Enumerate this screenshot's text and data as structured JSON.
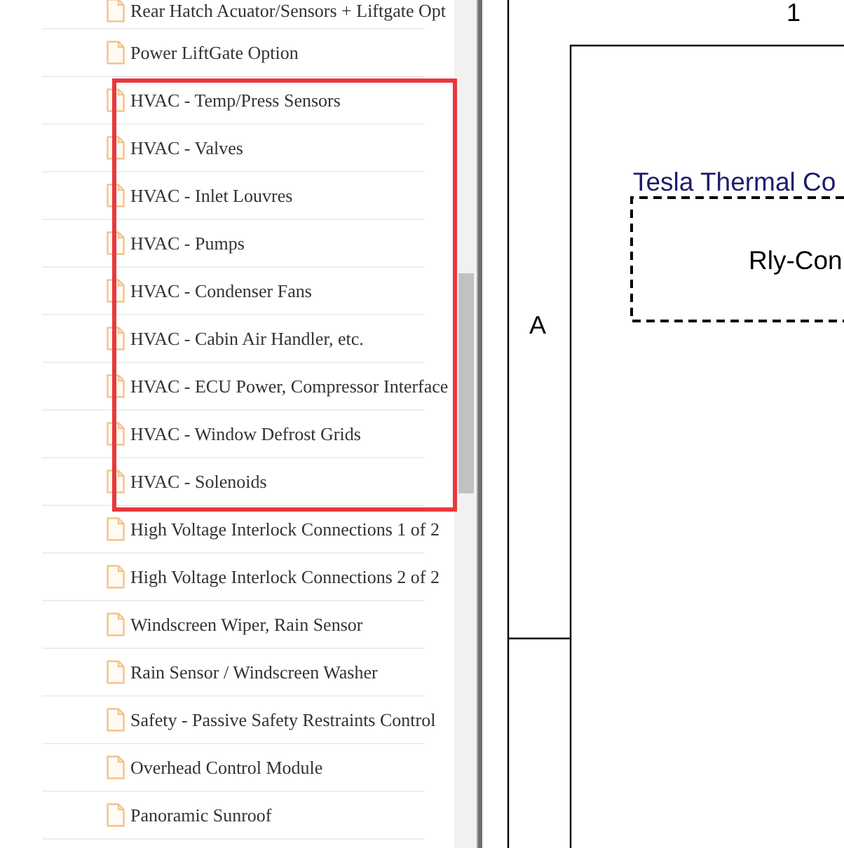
{
  "file_list": {
    "sections": [
      {
        "highlighted": false,
        "items": [
          {
            "label": "Rear Hatch Acuator/Sensors + Liftgate Opt"
          },
          {
            "label": "Power LiftGate Option"
          }
        ]
      },
      {
        "highlighted": true,
        "items": [
          {
            "label": "HVAC - Temp/Press Sensors"
          },
          {
            "label": "HVAC - Valves"
          },
          {
            "label": "HVAC - Inlet Louvres"
          },
          {
            "label": "HVAC - Pumps"
          },
          {
            "label": "HVAC - Condenser Fans"
          },
          {
            "label": "HVAC - Cabin Air Handler, etc."
          },
          {
            "label": "HVAC - ECU Power, Compressor Interface"
          },
          {
            "label": "HVAC - Window Defrost Grids"
          },
          {
            "label": "HVAC - Solenoids"
          }
        ]
      },
      {
        "highlighted": false,
        "items": [
          {
            "label": "High Voltage Interlock Connections 1 of 2"
          },
          {
            "label": "High Voltage Interlock Connections 2 of 2"
          },
          {
            "label": "Windscreen Wiper, Rain Sensor"
          },
          {
            "label": "Rain Sensor / Windscreen Washer"
          },
          {
            "label": "Safety - Passive Safety Restraints Control"
          },
          {
            "label": "Overhead Control Module"
          },
          {
            "label": "Panoramic Sunroof"
          }
        ]
      }
    ]
  },
  "schematic": {
    "column_label": "1",
    "row_label": "A",
    "title": "Tesla Thermal Co",
    "box_label": "Rly-Con"
  }
}
